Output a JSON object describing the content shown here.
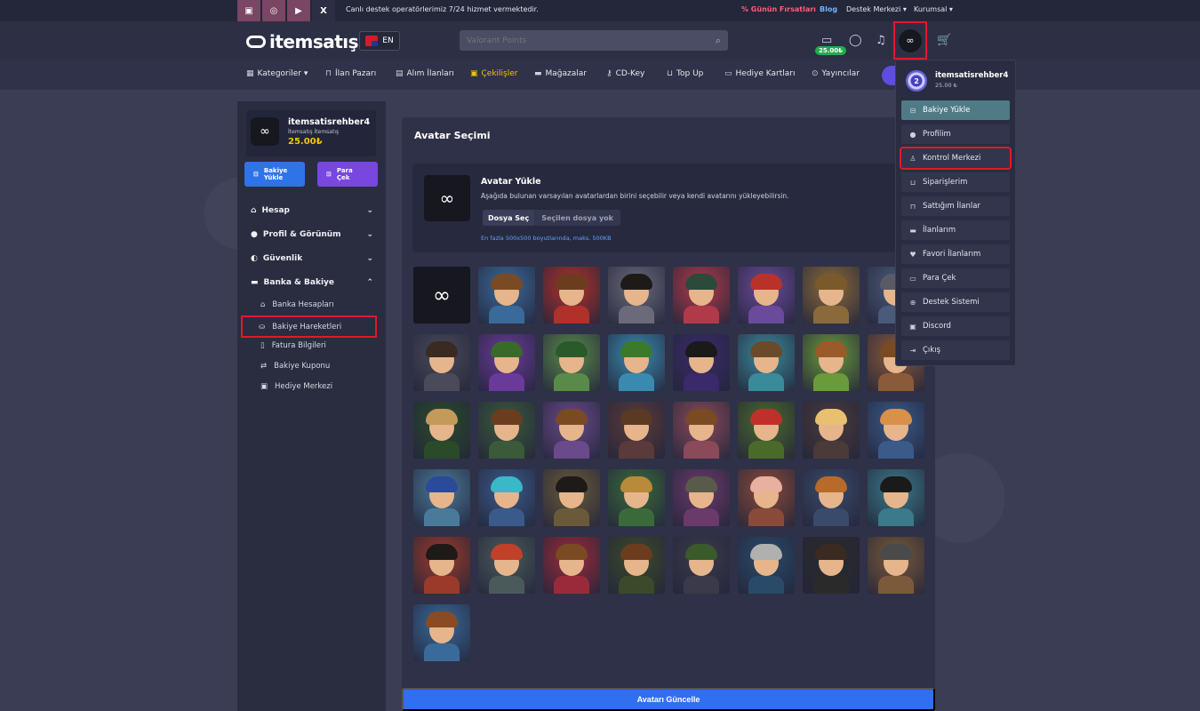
{
  "topbar": {
    "socials": [
      "discord-icon",
      "instagram-icon",
      "youtube-icon",
      "x-icon"
    ],
    "message": "Canlı destek operatörlerimiz 7/24 hizmet vermektedir.",
    "deals": "% Günün Fırsatları",
    "blog": "Blog",
    "help": "Destek Merkezi ▾",
    "corporate": "Kurumsal ▾"
  },
  "header": {
    "logo": "itemsatış",
    "lang": "EN",
    "search_placeholder": "Valorant Points",
    "wallet_balance": "25.00₺"
  },
  "nav": {
    "items": [
      {
        "label": "Kategoriler ▾",
        "icon": "grid-icon"
      },
      {
        "label": "İlan Pazarı",
        "icon": "basket-icon"
      },
      {
        "label": "Alım İlanları",
        "icon": "bag-icon"
      },
      {
        "label": "Çekilişler",
        "icon": "gift-icon"
      },
      {
        "label": "Mağazalar",
        "icon": "store-icon"
      },
      {
        "label": "CD-Key",
        "icon": "key-icon"
      },
      {
        "label": "Top Up",
        "icon": "cart-icon"
      },
      {
        "label": "Hediye Kartları",
        "icon": "card-icon"
      },
      {
        "label": "Yayıncılar",
        "icon": "gamepad-icon"
      }
    ]
  },
  "sidebar": {
    "username": "itemsatisrehber4",
    "subtitle": "İtemsatış İtemsatış",
    "balance": "25.00₺",
    "deposit_label": "Bakiye\nYükle",
    "withdraw_label": "Para\nÇek",
    "menus": [
      {
        "label": "Hesap",
        "open": false
      },
      {
        "label": "Profil & Görünüm",
        "open": false
      },
      {
        "label": "Güvenlik",
        "open": false
      },
      {
        "label": "Banka & Bakiye",
        "open": true
      }
    ],
    "subitems": [
      "Banka Hesapları",
      "Bakiye Hareketleri",
      "Fatura Bilgileri",
      "Bakiye Kuponu",
      "Hediye Merkezi"
    ]
  },
  "main": {
    "title": "Avatar Seçimi",
    "upload_title": "Avatar Yükle",
    "upload_desc": "Aşağıda bulunan varsayılan avatarlardan birini seçebilir veya kendi avatarını yükleyebilirsin.",
    "file_button": "Dosya Seç",
    "file_name": "Seçilen dosya yok",
    "upload_hint": "En fazla 500x500 boyutlarında, maks. 500KB",
    "submit": "Avatarı Güncelle"
  },
  "avatars": {
    "hair_colors": [
      "#7a4a22",
      "#6b3d1e",
      "#1e1a18",
      "#2a4a3a",
      "#b8322a",
      "#7a5a2a",
      "#5a5a66",
      "#3a2a22",
      "#3a6a2a",
      "#2a5a2a",
      "#3a7a2a",
      "#1a1a1a",
      "#6a4a2a",
      "#9a5a2a",
      "#7a4a22",
      "#c49a5a",
      "#6b3d1e",
      "#7a4a22",
      "#5a3a22",
      "#7a4a22",
      "#c0302a",
      "#e8c070",
      "#d8904a",
      "#2a4a9a",
      "#3ab8c8",
      "#1e1a18",
      "#b88a3a",
      "#5a5a4a",
      "#e8b0a0",
      "#b86a2a",
      "#1a1a1a",
      "#1e1a18",
      "#c0402a",
      "#7a4a22",
      "#6b3d1e",
      "#3a5a2a",
      "#b0b0b0",
      "#3a2a22",
      "#4a4a4a",
      "#8a4a22"
    ],
    "bg_colors": [
      "#3a6a9a",
      "#b0302a",
      "#6a6a7a",
      "#b03a4a",
      "#6a4a9a",
      "#8a6a3a",
      "#4a5a7a",
      "#4a4a5a",
      "#6a3a9a",
      "#5a8a4a",
      "#3a8ab0",
      "#3a2a6a",
      "#3a8a9a",
      "#6a9a3a",
      "#8a5a3a",
      "#2a4a2a",
      "#3a5a3a",
      "#6a4a8a",
      "#5a3a3a",
      "#8a4a5a",
      "#4a6a2a",
      "#4a3a3a",
      "#3a5a8a",
      "#4a7a9a",
      "#3a5a8a",
      "#6a5a3a",
      "#3a6a3a",
      "#6a3a6a",
      "#8a4a3a",
      "#3a4a6a",
      "#3a7a8a",
      "#9a3a2a",
      "#4a5a5a",
      "#9a2a3a",
      "#3a4a2a",
      "#3a3a4a",
      "#2a4a6a",
      "#2a2a2a",
      "#7a5a3a"
    ],
    "count": 41
  },
  "dropdown": {
    "username": "itemsatisrehber4",
    "balance": "25.00 ₺",
    "level": "2",
    "items": [
      {
        "label": "Bakiye Yükle",
        "icon": "wallet-icon"
      },
      {
        "label": "Profilim",
        "icon": "user-circle-icon"
      },
      {
        "label": "Kontrol Merkezi",
        "icon": "user-icon"
      },
      {
        "label": "Siparişlerim",
        "icon": "cart-icon"
      },
      {
        "label": "Sattığım İlanlar",
        "icon": "basket-icon"
      },
      {
        "label": "İlanlarım",
        "icon": "store-icon"
      },
      {
        "label": "Favori İlanlarım",
        "icon": "heart-icon"
      },
      {
        "label": "Para Çek",
        "icon": "card-icon"
      },
      {
        "label": "Destek Sistemi",
        "icon": "globe-icon"
      },
      {
        "label": "Discord",
        "icon": "discord-icon"
      },
      {
        "label": "Çıkış",
        "icon": "logout-icon"
      }
    ]
  }
}
